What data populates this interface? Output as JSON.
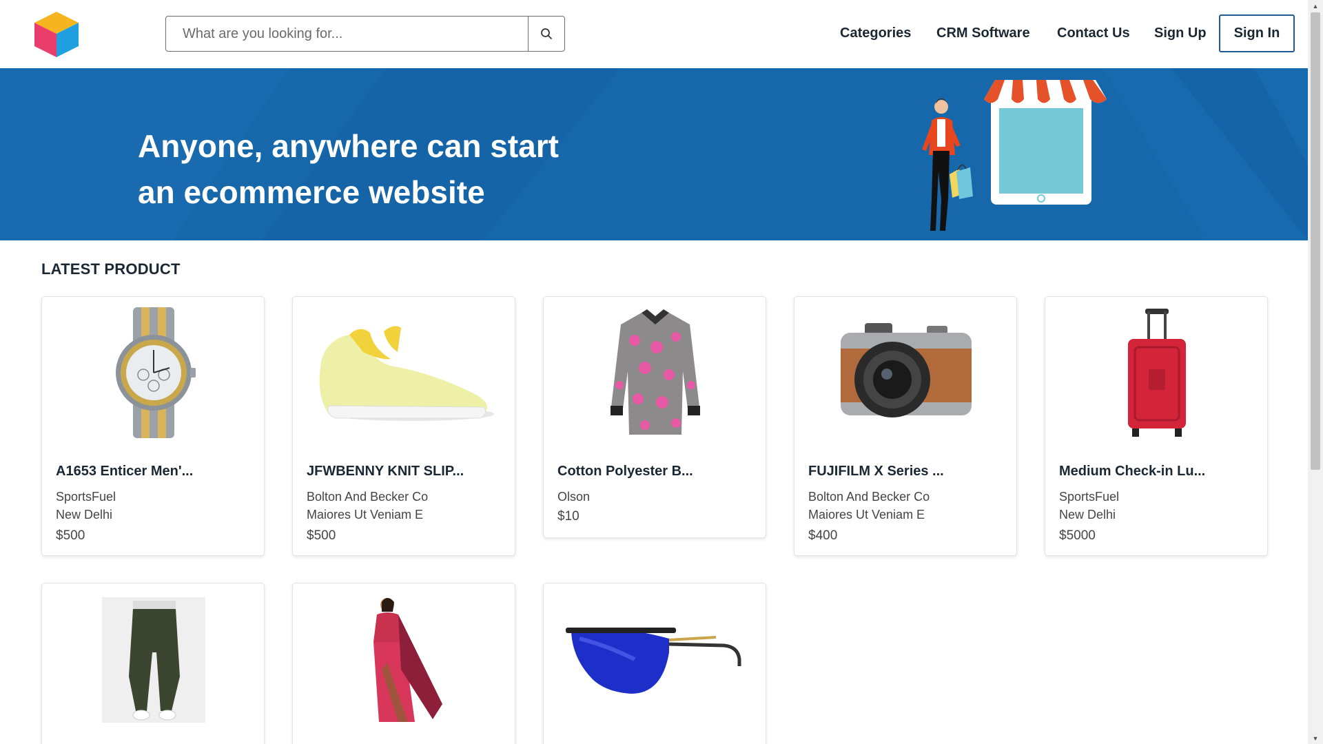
{
  "header": {
    "logo_icon": "cube-logo-icon",
    "search": {
      "placeholder": "What are you looking for...",
      "value": "",
      "icon": "search-icon"
    },
    "nav": {
      "categories": "Categories",
      "crm": "CRM Software",
      "contact": "Contact Us",
      "signup": "Sign Up",
      "signin": "Sign In"
    }
  },
  "hero": {
    "title_line1": "Anyone, anywhere can start",
    "title_line2": "an ecommerce website",
    "illustration": "shopper-storefront-illustration"
  },
  "section": {
    "title": "LATEST PRODUCT"
  },
  "products": [
    {
      "name": "A1653 Enticer Men'...",
      "seller": "SportsFuel",
      "location": "New Delhi",
      "price": "$500",
      "image": "watch-icon"
    },
    {
      "name": "JFWBENNY KNIT SLIP...",
      "seller": "Bolton And Becker Co",
      "location": "Maiores Ut Veniam E",
      "price": "$500",
      "image": "shoe-icon"
    },
    {
      "name": "Cotton Polyester B...",
      "seller": "Olson",
      "location": "",
      "price": "$10",
      "image": "shirt-icon"
    },
    {
      "name": "FUJIFILM X Series ...",
      "seller": "Bolton And Becker Co",
      "location": "Maiores Ut Veniam E",
      "price": "$400",
      "image": "camera-icon"
    },
    {
      "name": "Medium Check-in Lu...",
      "seller": "SportsFuel",
      "location": "New Delhi",
      "price": "$5000",
      "image": "luggage-icon"
    },
    {
      "name": "",
      "seller": "",
      "location": "",
      "price": "",
      "image": "trousers-icon"
    },
    {
      "name": "",
      "seller": "",
      "location": "",
      "price": "",
      "image": "saree-icon"
    },
    {
      "name": "",
      "seller": "",
      "location": "",
      "price": "",
      "image": "sunglasses-icon"
    }
  ],
  "colors": {
    "hero_bg": "#1767ab",
    "signin_border": "#1e5a96",
    "text_dark": "#1b2733"
  }
}
